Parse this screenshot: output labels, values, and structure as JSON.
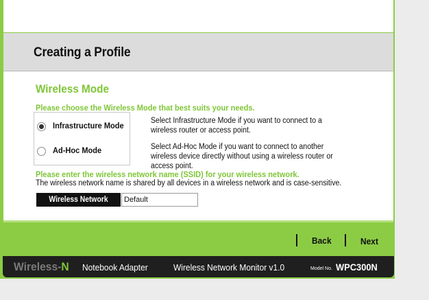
{
  "header": {
    "title": "Creating a Profile"
  },
  "section": {
    "title": "Wireless Mode",
    "mode_prompt": "Please choose the Wireless Mode that best suits your needs.",
    "modes": [
      {
        "label": "Infrastructure Mode",
        "selected": true,
        "description": "Select Infrastructure Mode if you want to connect to a wireless router or access point."
      },
      {
        "label": "Ad-Hoc Mode",
        "selected": false,
        "description": "Select Ad-Hoc Mode if you want to connect to another wireless device directly without using a wireless router or access point."
      }
    ],
    "ssid_prompt": "Please enter the wireless network name (SSID) for your wireless network.",
    "ssid_note": "The wireless network name is shared by all devices in a wireless network and is case-sensitive.",
    "ssid_label": "Wireless Network Name",
    "ssid_value": "Default"
  },
  "nav": {
    "back_label": "Back",
    "next_label": "Next"
  },
  "footer": {
    "brand_main": "Wireless-",
    "brand_accent": "N",
    "product": "Notebook Adapter",
    "app": "Wireless Network Monitor  v1.0",
    "model_label": "Model No.",
    "model_value": "WPC300N"
  },
  "colors": {
    "accent": "#8ccc45",
    "heading": "#7fc638",
    "footer": "#1f1f1f"
  }
}
